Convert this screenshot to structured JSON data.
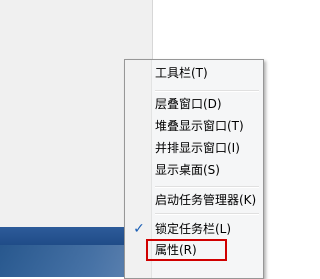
{
  "menu": {
    "items": [
      {
        "label": "工具栏(T)"
      },
      {
        "label": "层叠窗口(D)"
      },
      {
        "label": "堆叠显示窗口(T)"
      },
      {
        "label": "并排显示窗口(I)"
      },
      {
        "label": "显示桌面(S)"
      },
      {
        "label": "启动任务管理器(K)"
      },
      {
        "label": "锁定任务栏(L)",
        "checked": true
      },
      {
        "label": "属性(R)",
        "highlighted": true
      }
    ],
    "check_glyph": "✓"
  },
  "colors": {
    "menu_bg": "#f5f6f7",
    "highlight_border": "#d00000",
    "check": "#1b5fb5",
    "taskbar": "#2d5b9a"
  }
}
